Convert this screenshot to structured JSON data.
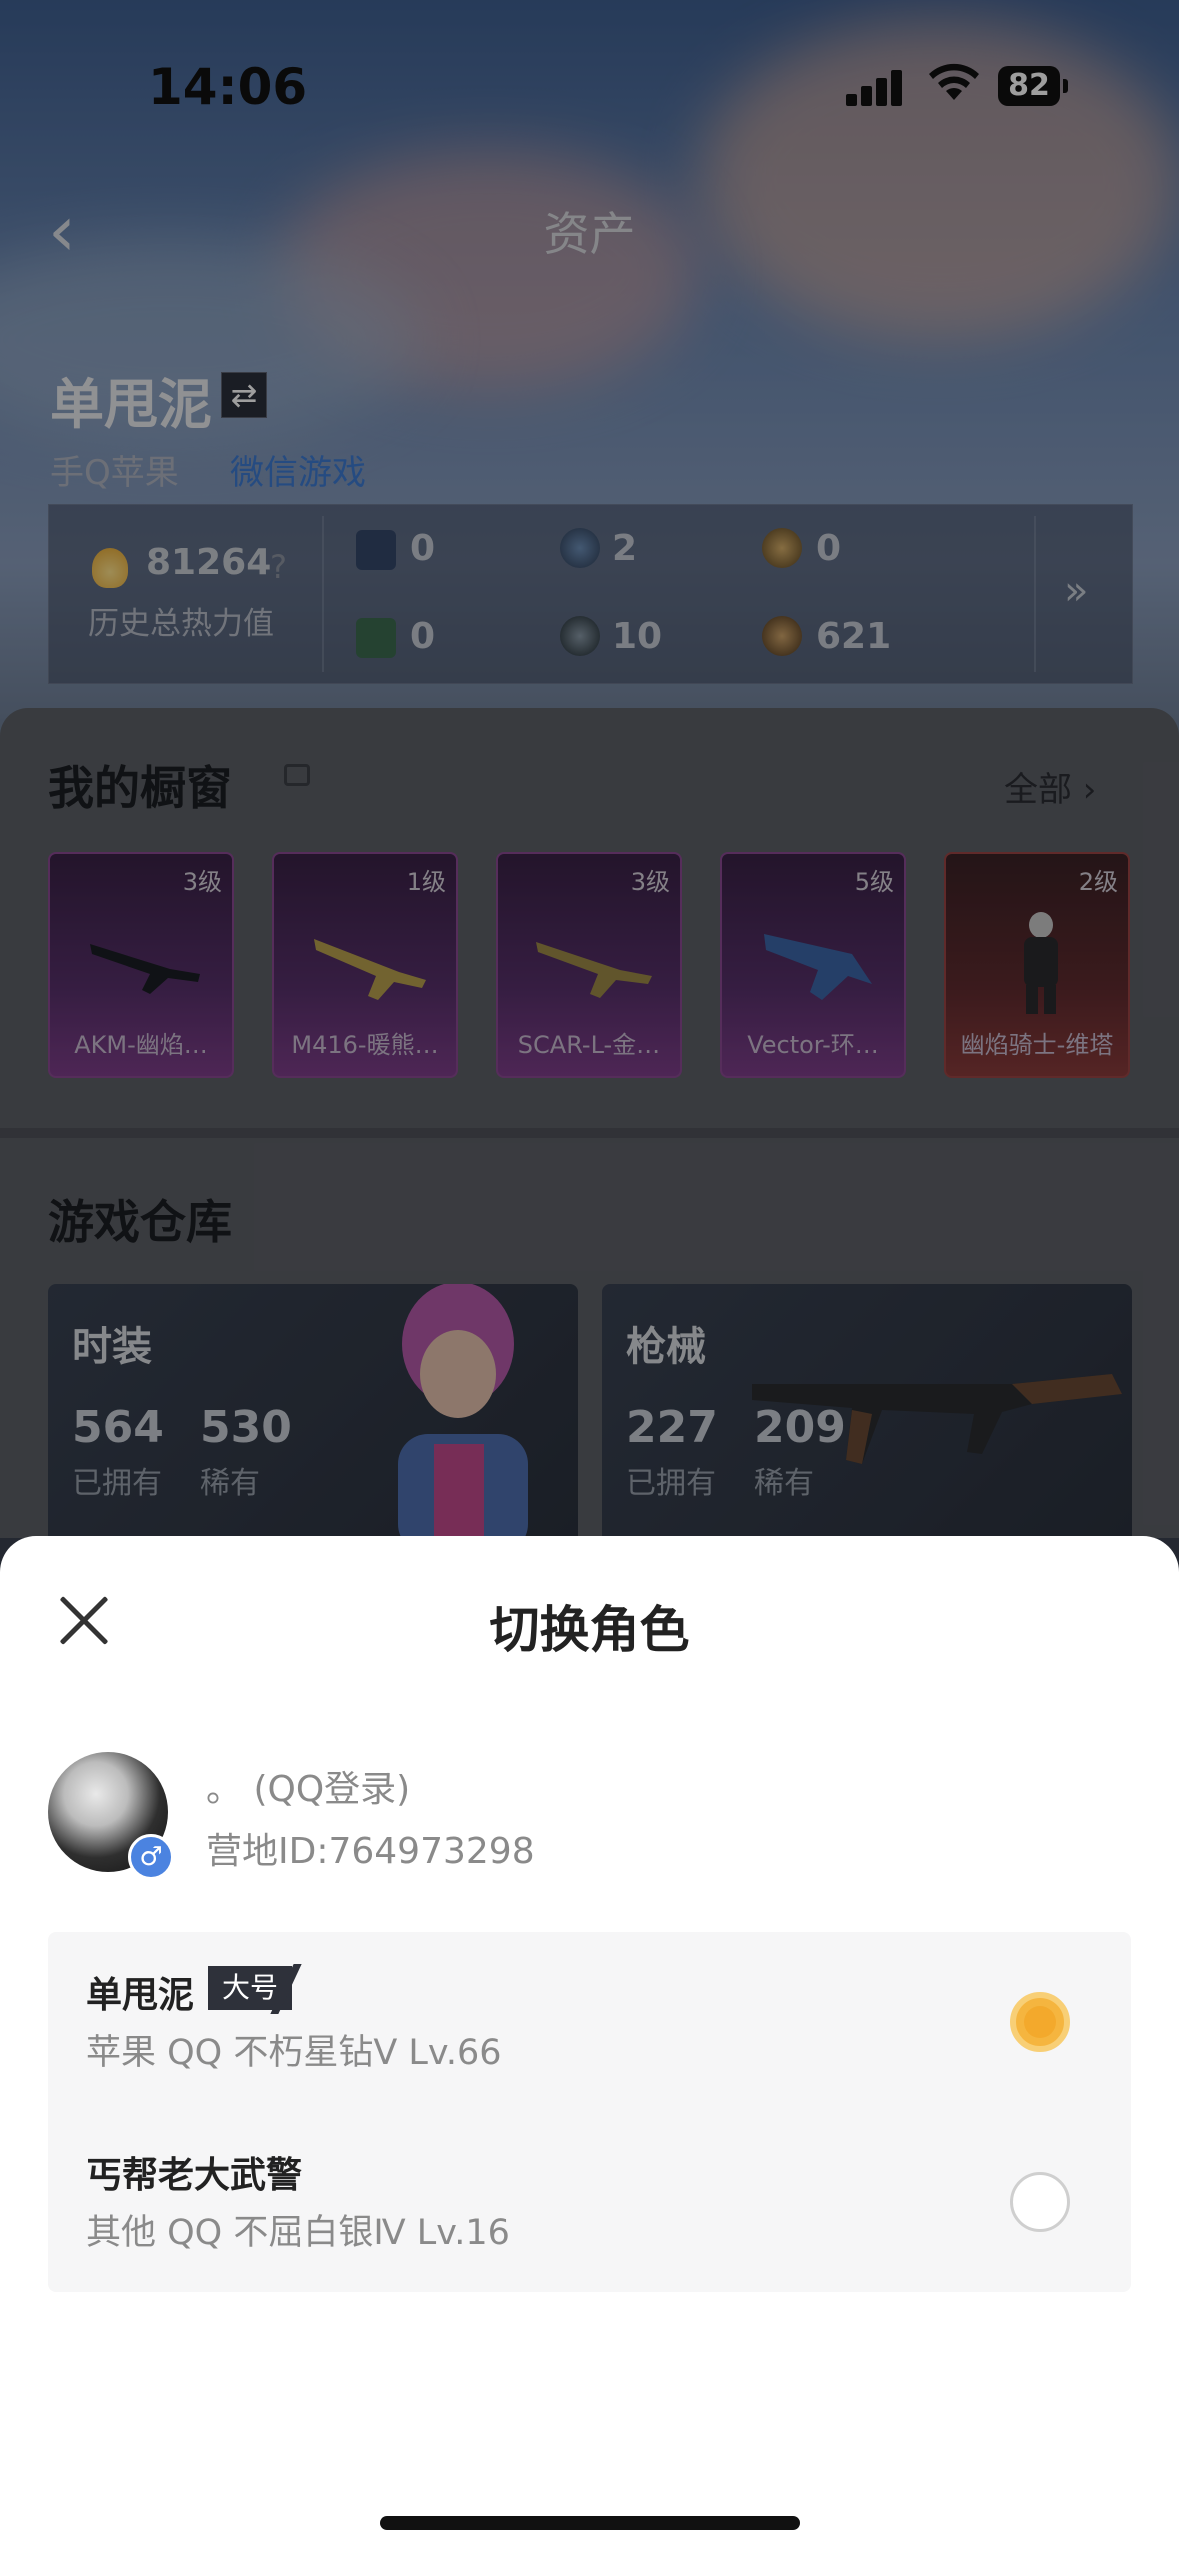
{
  "status_bar": {
    "time": "14:06",
    "battery": "82"
  },
  "nav": {
    "title": "资产",
    "back_icon": "chevron-left-icon"
  },
  "profile": {
    "player_name": "单甩泥",
    "platform": "手Q苹果",
    "platform_link": "微信游戏"
  },
  "stats": {
    "heat_value": "81264",
    "heat_label": "历史总热力值",
    "items": [
      "0",
      "2",
      "0",
      "0",
      "10",
      "621"
    ]
  },
  "showcase": {
    "title": "我的橱窗",
    "all_label": "全部",
    "cards": [
      {
        "level": "3级",
        "name": "AKM-幽焰…"
      },
      {
        "level": "1级",
        "name": "M416-暖熊…"
      },
      {
        "level": "3级",
        "name": "SCAR-L-金…"
      },
      {
        "level": "5级",
        "name": "Vector-环…"
      },
      {
        "level": "2级",
        "name": "幽焰骑士-维塔"
      }
    ]
  },
  "warehouse": {
    "title": "游戏仓库",
    "cards": [
      {
        "title": "时装",
        "owned": "564",
        "owned_label": "已拥有",
        "rare": "530",
        "rare_label": "稀有"
      },
      {
        "title": "枪械",
        "owned": "227",
        "owned_label": "已拥有",
        "rare": "209",
        "rare_label": "稀有"
      }
    ]
  },
  "modal": {
    "title": "切换角色",
    "account_name": "。 (QQ登录)",
    "account_id": "营地ID:764973298",
    "gender_icon": "male-icon",
    "roles": [
      {
        "name": "单甩泥",
        "tag": "大号",
        "subtitle": "苹果 QQ   不朽星钻Ⅴ   Lv.66",
        "selected": true
      },
      {
        "name": "丐帮老大武警",
        "subtitle": "其他 QQ   不屈白银Ⅳ   Lv.16",
        "selected": false
      }
    ]
  },
  "colors": {
    "accent": "#f5b53f",
    "link": "#3d7ad0"
  }
}
